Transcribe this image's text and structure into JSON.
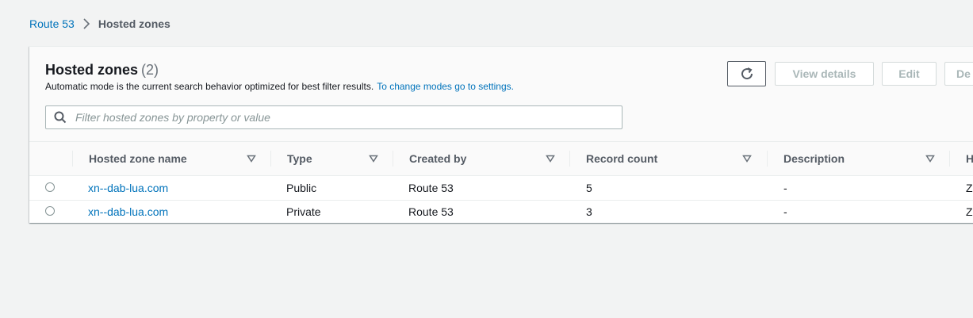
{
  "breadcrumb": {
    "root": "Route 53",
    "current": "Hosted zones"
  },
  "panel": {
    "title": "Hosted zones",
    "count": "(2)",
    "description": "Automatic mode is the current search behavior optimized for best filter results.",
    "settings_link": "To change modes go to settings."
  },
  "toolbar": {
    "refresh_icon": "refresh-icon",
    "view_details": "View details",
    "edit": "Edit",
    "delete_partial": "De"
  },
  "search": {
    "placeholder": "Filter hosted zones by property or value",
    "value": ""
  },
  "table": {
    "columns": [
      "Hosted zone name",
      "Type",
      "Created by",
      "Record count",
      "Description",
      "H"
    ],
    "rows": [
      {
        "name": "xn--dab-lua.com",
        "type": "Public",
        "created_by": "Route 53",
        "record_count": "5",
        "description": "-",
        "hosted_zone_id": "ZC"
      },
      {
        "name": "xn--dab-lua.com",
        "type": "Private",
        "created_by": "Route 53",
        "record_count": "3",
        "description": "-",
        "hosted_zone_id": "ZC"
      }
    ]
  },
  "colors": {
    "link": "#0073bb",
    "background": "#f2f3f3",
    "header_text": "#545b64",
    "disabled_text": "#aab7b8"
  }
}
